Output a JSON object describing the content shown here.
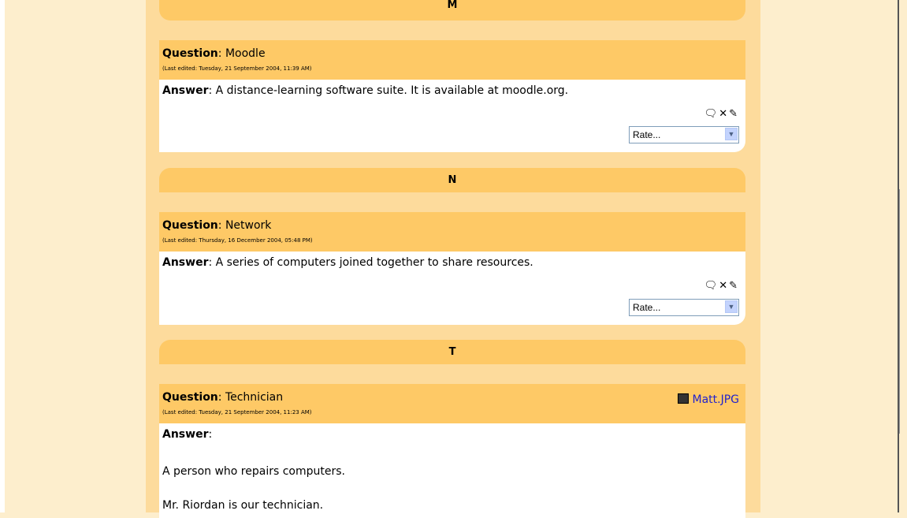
{
  "sections": {
    "m": "M",
    "n": "N",
    "t": "T"
  },
  "entries": [
    {
      "question_label": "Question",
      "question": "Moodle",
      "edited": "(Last edited: Tuesday, 21 September 2004, 11:39 AM)",
      "answer_label": "Answer",
      "answer": "A distance-learning software suite. It is available at moodle.org.",
      "rate": "Rate..."
    },
    {
      "question_label": "Question",
      "question": "Network",
      "edited": "(Last edited: Thursday, 16 December 2004, 05:48 PM)",
      "answer_label": "Answer",
      "answer": "A series of computers joined together to share resources.",
      "rate": "Rate..."
    },
    {
      "question_label": "Question",
      "question": "Technician",
      "edited": "(Last edited: Tuesday, 21 September 2004, 11:23 AM)",
      "answer_label": "Answer",
      "answer_p1": "A person who repairs computers.",
      "answer_p2": "Mr. Riordan is our technician.",
      "attachment": "Matt.JPG"
    }
  ],
  "icons": {
    "comment": "comment-icon",
    "delete": "delete-icon",
    "edit": "edit-icon"
  }
}
